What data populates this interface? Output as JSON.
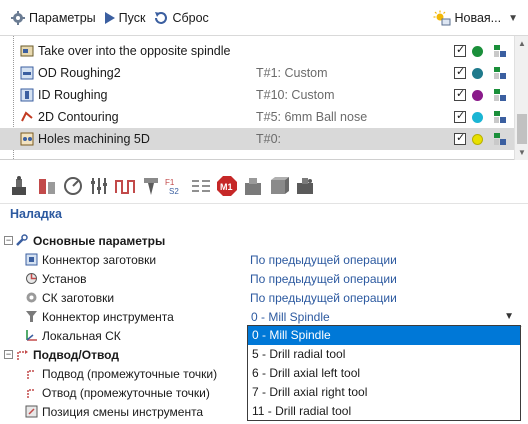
{
  "toolbar": {
    "params_label": "Параметры",
    "run_label": "Пуск",
    "reset_label": "Сброс",
    "new_label": "Новая..."
  },
  "operations": [
    {
      "name": "Take over into the opposite spindle",
      "tool": "",
      "color": "#1a8f3a"
    },
    {
      "name": "OD Roughing2",
      "tool": "T#1: Custom",
      "color": "#1f7a8c"
    },
    {
      "name": "ID Roughing",
      "tool": "T#10: Custom",
      "color": "#8a1a8a"
    },
    {
      "name": "2D Contouring",
      "tool": "T#5: 6mm Ball nose",
      "color": "#1ab5d4"
    },
    {
      "name": "Holes machining 5D",
      "tool": "T#0:",
      "color": "#e8e000"
    }
  ],
  "section_title": "Наладка",
  "props": {
    "group_main": "Основные параметры",
    "stock_connector": {
      "label": "Коннектор заготовки",
      "value": "По предыдущей операции"
    },
    "setup": {
      "label": "Установ",
      "value": "По предыдущей операции"
    },
    "stock_cs": {
      "label": "СК заготовки",
      "value": "По предыдущей операции"
    },
    "tool_connector": {
      "label": "Коннектор инструмента",
      "value": "0 - Mill Spindle"
    },
    "local_cs": {
      "label": "Локальная СК"
    },
    "group_approach": "Подвод/Отвод",
    "approach": {
      "label": "Подвод (промежуточные точки)"
    },
    "retract": {
      "label": "Отвод (промежуточные точки)"
    },
    "tool_change": {
      "label": "Позиция смены инструмента"
    }
  },
  "dropdown_options": [
    "0 - Mill Spindle",
    "5 - Drill radial tool",
    "6 - Drill axial left tool",
    "7 - Drill axial right tool",
    "11 - Drill radial tool"
  ],
  "colors": {
    "accent": "#2d5aa0",
    "selection": "#0078d7",
    "row_selected": "#d9d9d9"
  }
}
